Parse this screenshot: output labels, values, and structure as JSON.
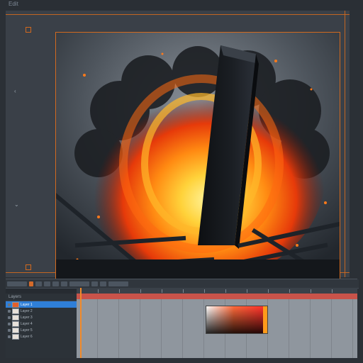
{
  "app": {
    "title": "Edit"
  },
  "timeline": {
    "layers_header": "Layers",
    "layers": [
      {
        "label": "Layer 1",
        "selected": true
      },
      {
        "label": "Layer 2",
        "selected": false
      },
      {
        "label": "Layer 3",
        "selected": false
      },
      {
        "label": "Layer 4",
        "selected": false
      },
      {
        "label": "Layer 5",
        "selected": false
      },
      {
        "label": "Layer 6",
        "selected": false
      }
    ]
  },
  "colors": {
    "accent_orange": "#d2691e",
    "selection_blue": "#2f7fd8",
    "playhead": "#f28a2a",
    "track_red": "#c9534a"
  }
}
